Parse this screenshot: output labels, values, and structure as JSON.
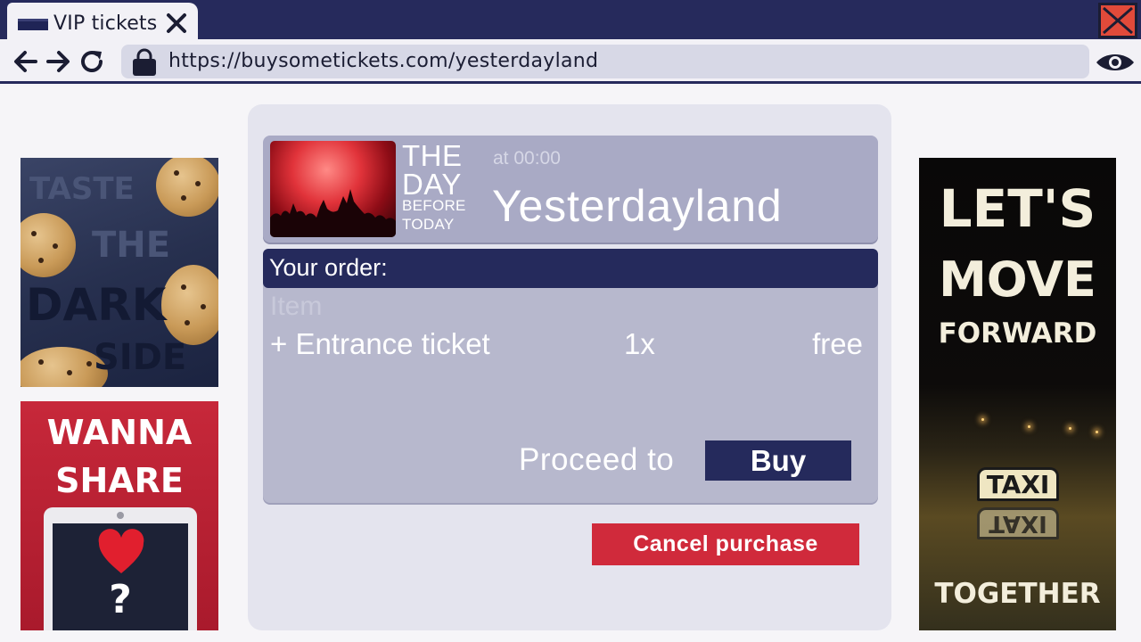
{
  "browser": {
    "tab_title": "VIP tickets",
    "url": "https://buysometickets.com/yesterdayland"
  },
  "event": {
    "logo_line1": "THE",
    "logo_line2": "DAY",
    "logo_line3": "BEFORE",
    "logo_line4": "TODAY",
    "time": "at 00:00",
    "name": "Yesterdayland"
  },
  "order": {
    "header": "Your order:",
    "column_item": "Item",
    "rows": [
      {
        "item": "+ Entrance ticket",
        "qty": "1x",
        "price": "free"
      }
    ],
    "proceed_text": "Proceed to",
    "buy_label": "Buy",
    "cancel_label": "Cancel purchase"
  },
  "ads": {
    "cookies": {
      "line1": "TASTE",
      "line2": "THE",
      "line3": "DARK",
      "line4": "SIDE"
    },
    "share": {
      "line1": "WANNA",
      "line2": "SHARE",
      "symbol": "?"
    },
    "taxi": {
      "line1": "LET'S",
      "line2": "MOVE",
      "line3": "FORWARD",
      "line4": "TOGETHER",
      "sign": "TAXI"
    }
  },
  "colors": {
    "navy": "#252a5c",
    "cancel_red": "#d02a3b",
    "close_red": "#e14a3a"
  },
  "icons": [
    "tab-page-icon",
    "close-icon",
    "back-arrow-icon",
    "forward-arrow-icon",
    "reload-icon",
    "lock-icon",
    "eye-icon"
  ]
}
